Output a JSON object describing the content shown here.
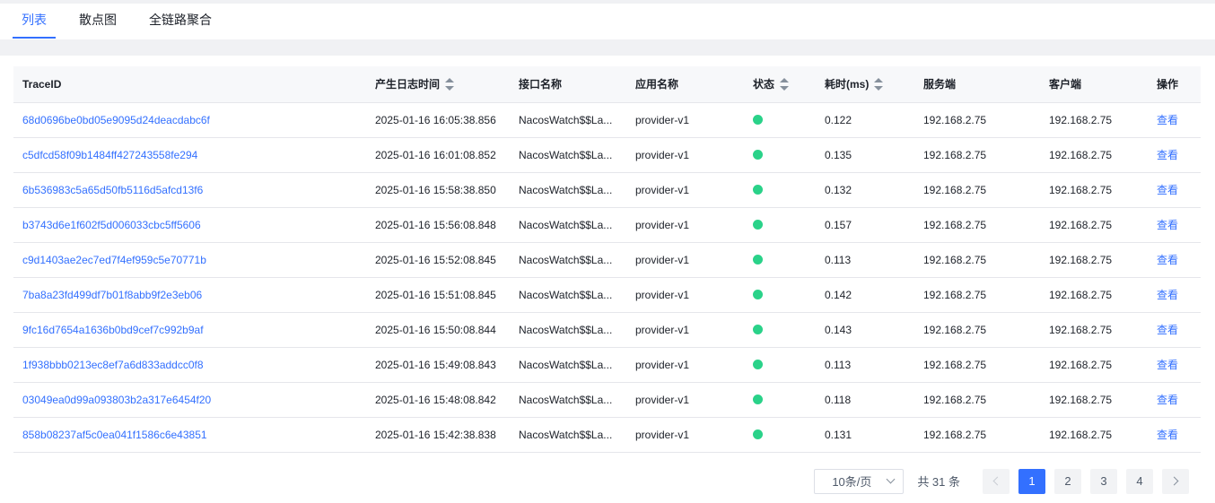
{
  "tabs": [
    {
      "label": "列表",
      "active": true
    },
    {
      "label": "散点图",
      "active": false
    },
    {
      "label": "全链路聚合",
      "active": false
    }
  ],
  "table": {
    "columns": [
      "TraceID",
      "产生日志时间",
      "接口名称",
      "应用名称",
      "状态",
      "耗时(ms)",
      "服务端",
      "客户端",
      "操作"
    ],
    "status_color": "#2ad289",
    "rows": [
      {
        "trace_id": "68d0696be0bd05e9095d24deacdabc6f",
        "time": "2025-01-16 16:05:38.856",
        "api": "NacosWatch$$La...",
        "app": "provider-v1",
        "status": "success",
        "cost": "0.122",
        "server": "192.168.2.75",
        "client": "192.168.2.75",
        "action": "查看"
      },
      {
        "trace_id": "c5dfcd58f09b1484ff427243558fe294",
        "time": "2025-01-16 16:01:08.852",
        "api": "NacosWatch$$La...",
        "app": "provider-v1",
        "status": "success",
        "cost": "0.135",
        "server": "192.168.2.75",
        "client": "192.168.2.75",
        "action": "查看"
      },
      {
        "trace_id": "6b536983c5a65d50fb5116d5afcd13f6",
        "time": "2025-01-16 15:58:38.850",
        "api": "NacosWatch$$La...",
        "app": "provider-v1",
        "status": "success",
        "cost": "0.132",
        "server": "192.168.2.75",
        "client": "192.168.2.75",
        "action": "查看"
      },
      {
        "trace_id": "b3743d6e1f602f5d006033cbc5ff5606",
        "time": "2025-01-16 15:56:08.848",
        "api": "NacosWatch$$La...",
        "app": "provider-v1",
        "status": "success",
        "cost": "0.157",
        "server": "192.168.2.75",
        "client": "192.168.2.75",
        "action": "查看"
      },
      {
        "trace_id": "c9d1403ae2ec7ed7f4ef959c5e70771b",
        "time": "2025-01-16 15:52:08.845",
        "api": "NacosWatch$$La...",
        "app": "provider-v1",
        "status": "success",
        "cost": "0.113",
        "server": "192.168.2.75",
        "client": "192.168.2.75",
        "action": "查看"
      },
      {
        "trace_id": "7ba8a23fd499df7b01f8abb9f2e3eb06",
        "time": "2025-01-16 15:51:08.845",
        "api": "NacosWatch$$La...",
        "app": "provider-v1",
        "status": "success",
        "cost": "0.142",
        "server": "192.168.2.75",
        "client": "192.168.2.75",
        "action": "查看"
      },
      {
        "trace_id": "9fc16d7654a1636b0bd9cef7c992b9af",
        "time": "2025-01-16 15:50:08.844",
        "api": "NacosWatch$$La...",
        "app": "provider-v1",
        "status": "success",
        "cost": "0.143",
        "server": "192.168.2.75",
        "client": "192.168.2.75",
        "action": "查看"
      },
      {
        "trace_id": "1f938bbb0213ec8ef7a6d833addcc0f8",
        "time": "2025-01-16 15:49:08.843",
        "api": "NacosWatch$$La...",
        "app": "provider-v1",
        "status": "success",
        "cost": "0.113",
        "server": "192.168.2.75",
        "client": "192.168.2.75",
        "action": "查看"
      },
      {
        "trace_id": "03049ea0d99a093803b2a317e6454f20",
        "time": "2025-01-16 15:48:08.842",
        "api": "NacosWatch$$La...",
        "app": "provider-v1",
        "status": "success",
        "cost": "0.118",
        "server": "192.168.2.75",
        "client": "192.168.2.75",
        "action": "查看"
      },
      {
        "trace_id": "858b08237af5c0ea041f1586c6e43851",
        "time": "2025-01-16 15:42:38.838",
        "api": "NacosWatch$$La...",
        "app": "provider-v1",
        "status": "success",
        "cost": "0.131",
        "server": "192.168.2.75",
        "client": "192.168.2.75",
        "action": "查看"
      }
    ]
  },
  "pagination": {
    "page_size": "10条/页",
    "total": "共 31 条",
    "pages": [
      "1",
      "2",
      "3",
      "4"
    ],
    "current": "1"
  },
  "accent_color": "#3370ff"
}
